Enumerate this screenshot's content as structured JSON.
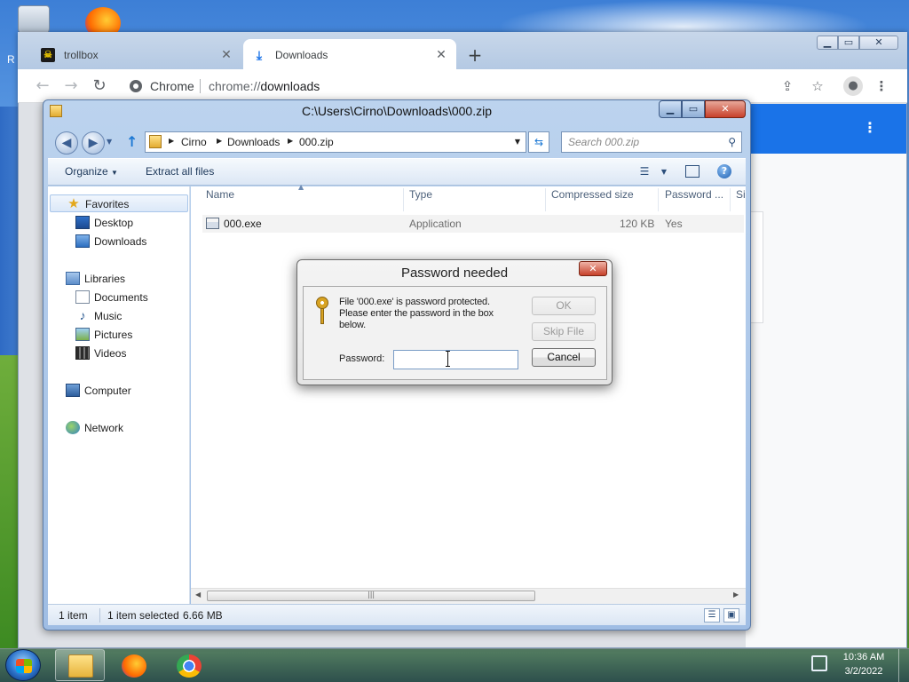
{
  "desktop": {
    "edge_mark": "R"
  },
  "taskbar": {
    "clock_time": "10:36 AM",
    "clock_date": "3/2/2022"
  },
  "chrome": {
    "tabs": [
      {
        "title": "trollbox",
        "favicon": "trollbox-favicon",
        "active": false
      },
      {
        "title": "Downloads",
        "favicon": "download-icon",
        "active": true
      }
    ],
    "new_tab_glyph": "+",
    "omnibox": {
      "label": "Chrome",
      "url_scheme": "chrome://",
      "url_path": "downloads"
    }
  },
  "explorer": {
    "title": "C:\\Users\\Cirno\\Downloads\\000.zip",
    "breadcrumbs": [
      "Cirno",
      "Downloads",
      "000.zip"
    ],
    "search_placeholder": "Search 000.zip",
    "commands": {
      "organize": "Organize",
      "extract": "Extract all files"
    },
    "nav": {
      "favorites": "Favorites",
      "desktop": "Desktop",
      "downloads": "Downloads",
      "libraries": "Libraries",
      "documents": "Documents",
      "music": "Music",
      "pictures": "Pictures",
      "videos": "Videos",
      "computer": "Computer",
      "network": "Network"
    },
    "columns": {
      "name": "Name",
      "type": "Type",
      "compressed_size": "Compressed size",
      "password": "Password ...",
      "size": "Si"
    },
    "files": [
      {
        "name": "000.exe",
        "type": "Application",
        "compressed_size": "120 KB",
        "password": "Yes"
      }
    ],
    "status": {
      "count": "1 item",
      "selected": "1 item selected",
      "size": "6.66 MB"
    }
  },
  "dialog": {
    "title": "Password needed",
    "message": "File '000.exe' is password protected. Please enter the password in the box below.",
    "password_label": "Password:",
    "password_value": "",
    "ok": "OK",
    "skip": "Skip File",
    "cancel": "Cancel"
  }
}
